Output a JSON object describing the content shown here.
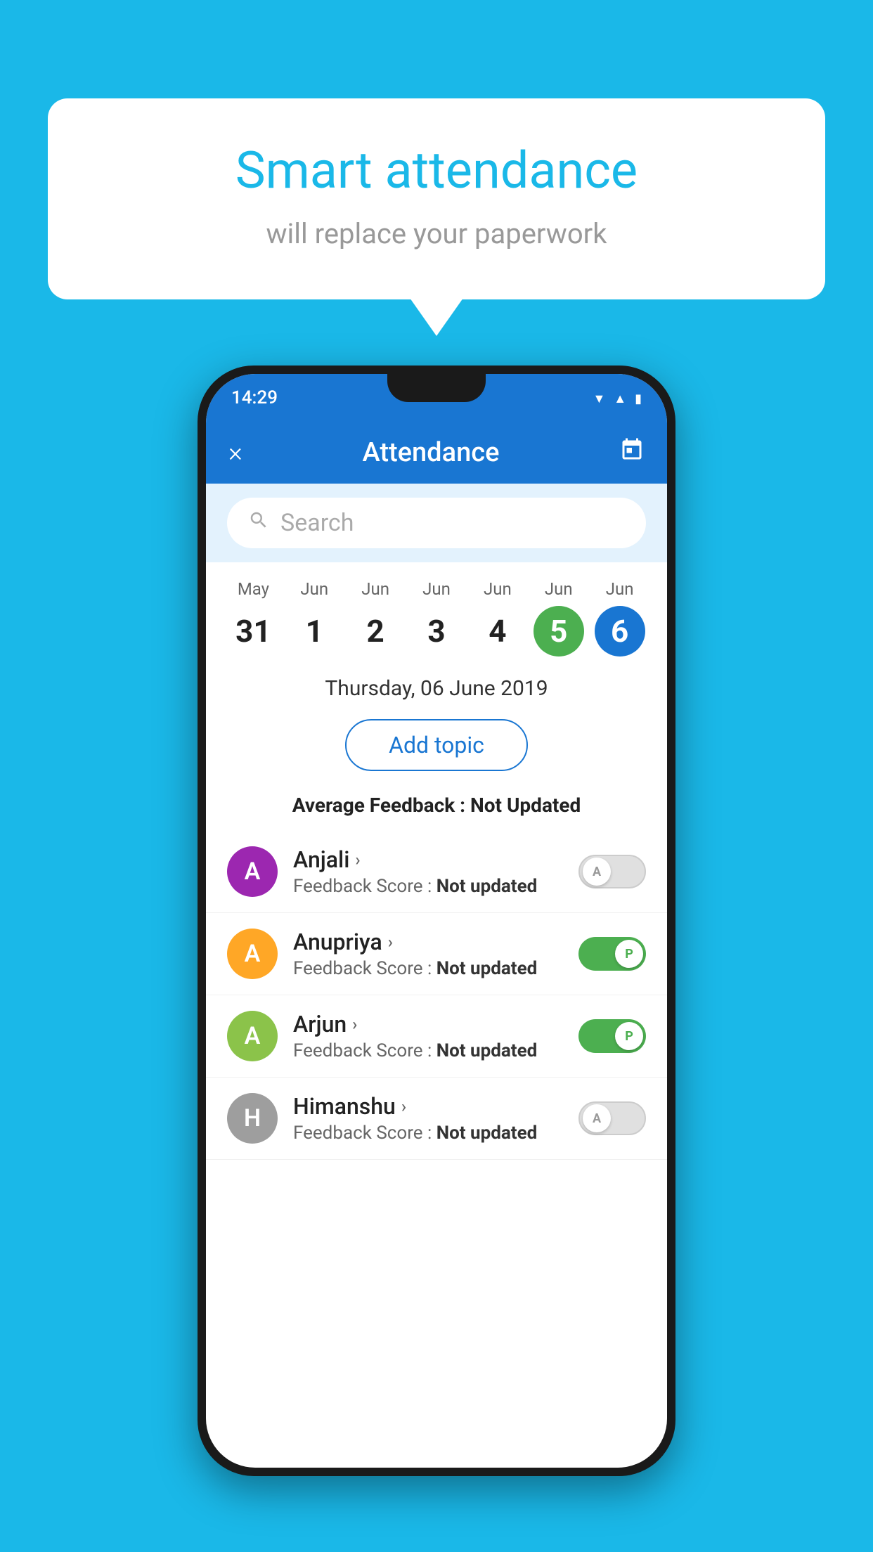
{
  "background_color": "#1ab8e8",
  "bubble": {
    "title": "Smart attendance",
    "subtitle": "will replace your paperwork"
  },
  "status_bar": {
    "time": "14:29",
    "icons": [
      "wifi",
      "signal",
      "battery"
    ]
  },
  "header": {
    "title": "Attendance",
    "close_label": "×",
    "calendar_icon": "calendar-icon"
  },
  "search": {
    "placeholder": "Search"
  },
  "calendar": {
    "days": [
      {
        "month": "May",
        "date": "31",
        "state": "normal"
      },
      {
        "month": "Jun",
        "date": "1",
        "state": "normal"
      },
      {
        "month": "Jun",
        "date": "2",
        "state": "normal"
      },
      {
        "month": "Jun",
        "date": "3",
        "state": "normal"
      },
      {
        "month": "Jun",
        "date": "4",
        "state": "normal"
      },
      {
        "month": "Jun",
        "date": "5",
        "state": "today"
      },
      {
        "month": "Jun",
        "date": "6",
        "state": "selected"
      }
    ]
  },
  "selected_date_label": "Thursday, 06 June 2019",
  "add_topic_label": "Add topic",
  "avg_feedback_label": "Average Feedback : ",
  "avg_feedback_value": "Not Updated",
  "students": [
    {
      "name": "Anjali",
      "avatar_letter": "A",
      "avatar_color": "#9c27b0",
      "feedback_label": "Feedback Score : ",
      "feedback_value": "Not updated",
      "toggle_state": "off",
      "toggle_letter": "A"
    },
    {
      "name": "Anupriya",
      "avatar_letter": "A",
      "avatar_color": "#ffa726",
      "feedback_label": "Feedback Score : ",
      "feedback_value": "Not updated",
      "toggle_state": "on",
      "toggle_letter": "P"
    },
    {
      "name": "Arjun",
      "avatar_letter": "A",
      "avatar_color": "#8bc34a",
      "feedback_label": "Feedback Score : ",
      "feedback_value": "Not updated",
      "toggle_state": "on",
      "toggle_letter": "P"
    },
    {
      "name": "Himanshu",
      "avatar_letter": "H",
      "avatar_color": "#9e9e9e",
      "feedback_label": "Feedback Score : ",
      "feedback_value": "Not updated",
      "toggle_state": "off",
      "toggle_letter": "A"
    }
  ]
}
